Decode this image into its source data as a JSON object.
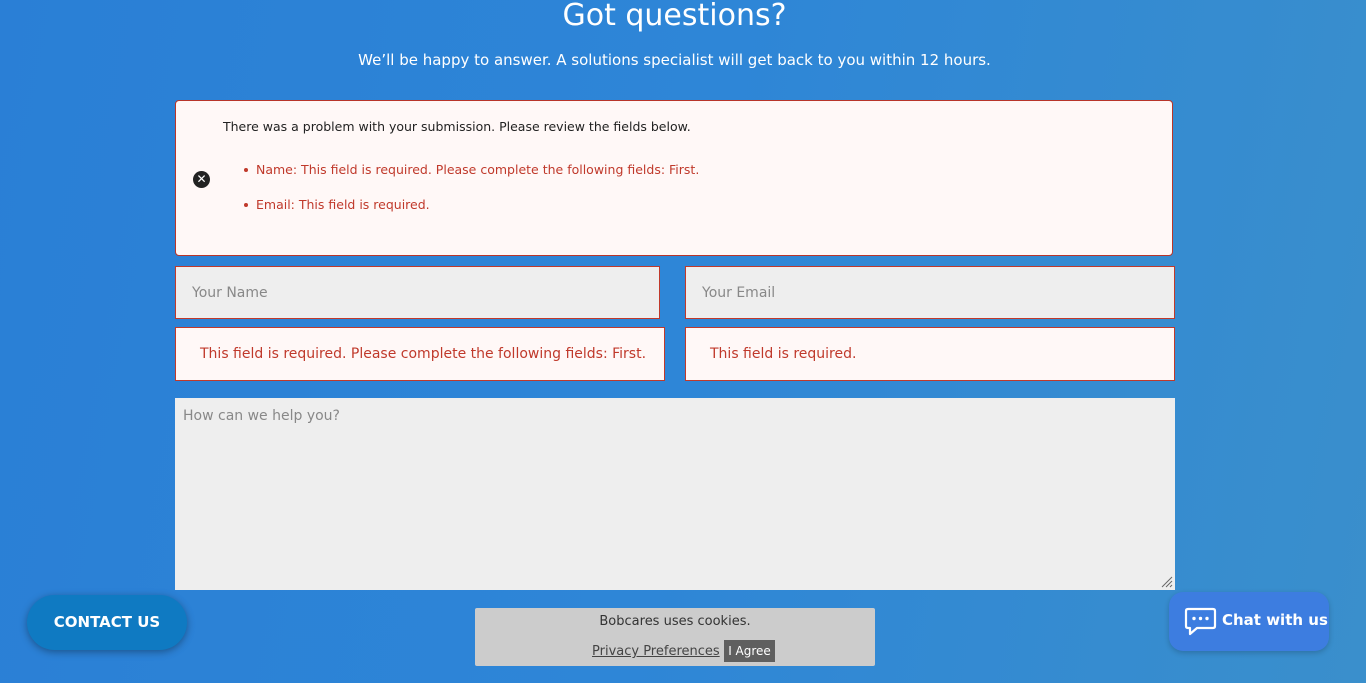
{
  "header": {
    "title": "Got questions?",
    "subtitle": "We’ll be happy to answer. A solutions specialist will get back to you within 12 hours."
  },
  "error_panel": {
    "icon": "close-circle-icon",
    "heading": "There was a problem with your submission. Please review the fields below.",
    "items": [
      "Name: This field is required. Please complete the following fields: First.",
      "Email: This field is required."
    ]
  },
  "form": {
    "name_placeholder": "Your Name",
    "email_placeholder": "Your Email",
    "name_error": "This field is required. Please complete the following fields: First.",
    "email_error": "This field is required.",
    "message_placeholder": "How can we help you?"
  },
  "contact_button": {
    "label": "CONTACT US"
  },
  "cookie_bar": {
    "text": "Bobcares uses cookies.",
    "privacy_link": "Privacy Preferences",
    "agree_label": "I Agree"
  },
  "chat": {
    "icon": "chat-bubble-icon",
    "label": "Chat with us"
  },
  "colors": {
    "background": "#2e86d7",
    "error": "#c0392b",
    "chat_button": "#3d7de0",
    "contact_button": "#0f7ac2"
  }
}
